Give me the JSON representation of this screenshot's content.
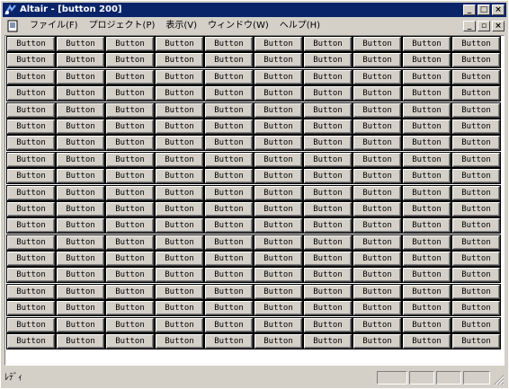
{
  "titlebar": {
    "title": "Altair - [button 200]",
    "minimize_glyph": "_",
    "maximize_glyph": "□",
    "close_glyph": "×"
  },
  "menubar": {
    "items": [
      "ファイル(F)",
      "プロジェクト(P)",
      "表示(V)",
      "ウィンドウ(W)",
      "ヘルプ(H)"
    ],
    "mdi_minimize_glyph": "_",
    "mdi_restore_glyph": "▫",
    "mdi_close_glyph": "×"
  },
  "grid": {
    "button_label": "Button",
    "rows": 19,
    "columns": 10
  },
  "statusbar": {
    "text": "ﾚﾃﾞｨ"
  },
  "colors": {
    "face": "#d4d0c8",
    "titlebar": "#0a246a",
    "client": "#ffffff"
  }
}
